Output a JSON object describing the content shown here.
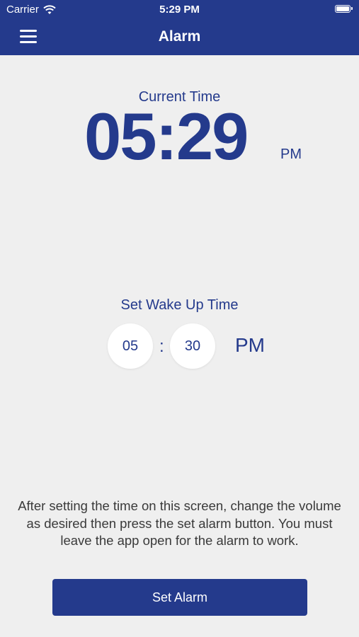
{
  "status_bar": {
    "carrier": "Carrier",
    "time": "5:29 PM",
    "wifi_icon": "wifi-icon",
    "battery_icon": "battery-icon"
  },
  "nav": {
    "title": "Alarm",
    "menu_icon": "hamburger-menu-icon"
  },
  "current": {
    "label": "Current Time",
    "time": "05:29",
    "ampm": "PM"
  },
  "wake": {
    "label": "Set Wake Up Time",
    "hour": "05",
    "separator": ":",
    "minute": "30",
    "ampm": "PM"
  },
  "instructions": "After setting the time on this screen, change the volume as desired then press the set alarm button. You must leave the app open for the alarm to work.",
  "button": {
    "label": "Set Alarm"
  },
  "colors": {
    "brand": "#243a8c",
    "background": "#efefef",
    "text": "#3a3a3a"
  }
}
